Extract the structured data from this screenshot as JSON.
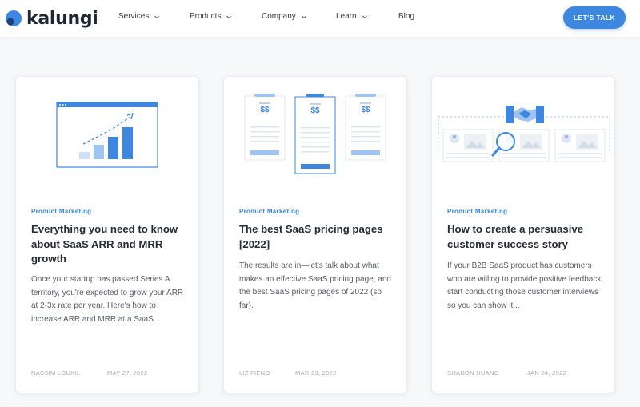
{
  "header": {
    "logo_text": "kalungi",
    "nav": [
      {
        "label": "Services",
        "has_dropdown": true
      },
      {
        "label": "Products",
        "has_dropdown": true
      },
      {
        "label": "Company",
        "has_dropdown": true
      },
      {
        "label": "Learn",
        "has_dropdown": true
      },
      {
        "label": "Blog",
        "has_dropdown": false
      }
    ],
    "cta_label": "LET'S TALK"
  },
  "colors": {
    "accent": "#3d87e0",
    "accent_light": "#9fc4f2",
    "text_dark": "#262b33",
    "text_muted": "#a6abb3"
  },
  "cards": [
    {
      "category": "Product Marketing",
      "title": "Everything you need to know about SaaS ARR and MRR growth",
      "excerpt": "Once your startup has passed Series A territory, you're expected to grow your ARR at 2-3x rate per year. Here's how to increase ARR and MRR at a SaaS...",
      "author": "NASSIM LOUKIL",
      "date": "MAY 27, 2022",
      "illustration": "growth-chart-icon"
    },
    {
      "category": "Product Marketing",
      "title": "The best SaaS pricing pages [2022]",
      "excerpt": "The results are in—let's talk about what makes an effective SaaS pricing page, and the best SaaS pricing pages of 2022 (so far).",
      "author": "LIZ FIENO",
      "date": "MAR 23, 2022",
      "illustration": "pricing-tables-icon",
      "price_label": "$$"
    },
    {
      "category": "Product Marketing",
      "title": "How to create a persuasive customer success story",
      "excerpt": "If your B2B SaaS product has customers who are willing to provide positive feedback, start conducting those customer interviews so you can show it...",
      "author": "SHARON HUANG",
      "date": "JAN 24, 2022",
      "illustration": "handshake-profiles-icon"
    }
  ]
}
